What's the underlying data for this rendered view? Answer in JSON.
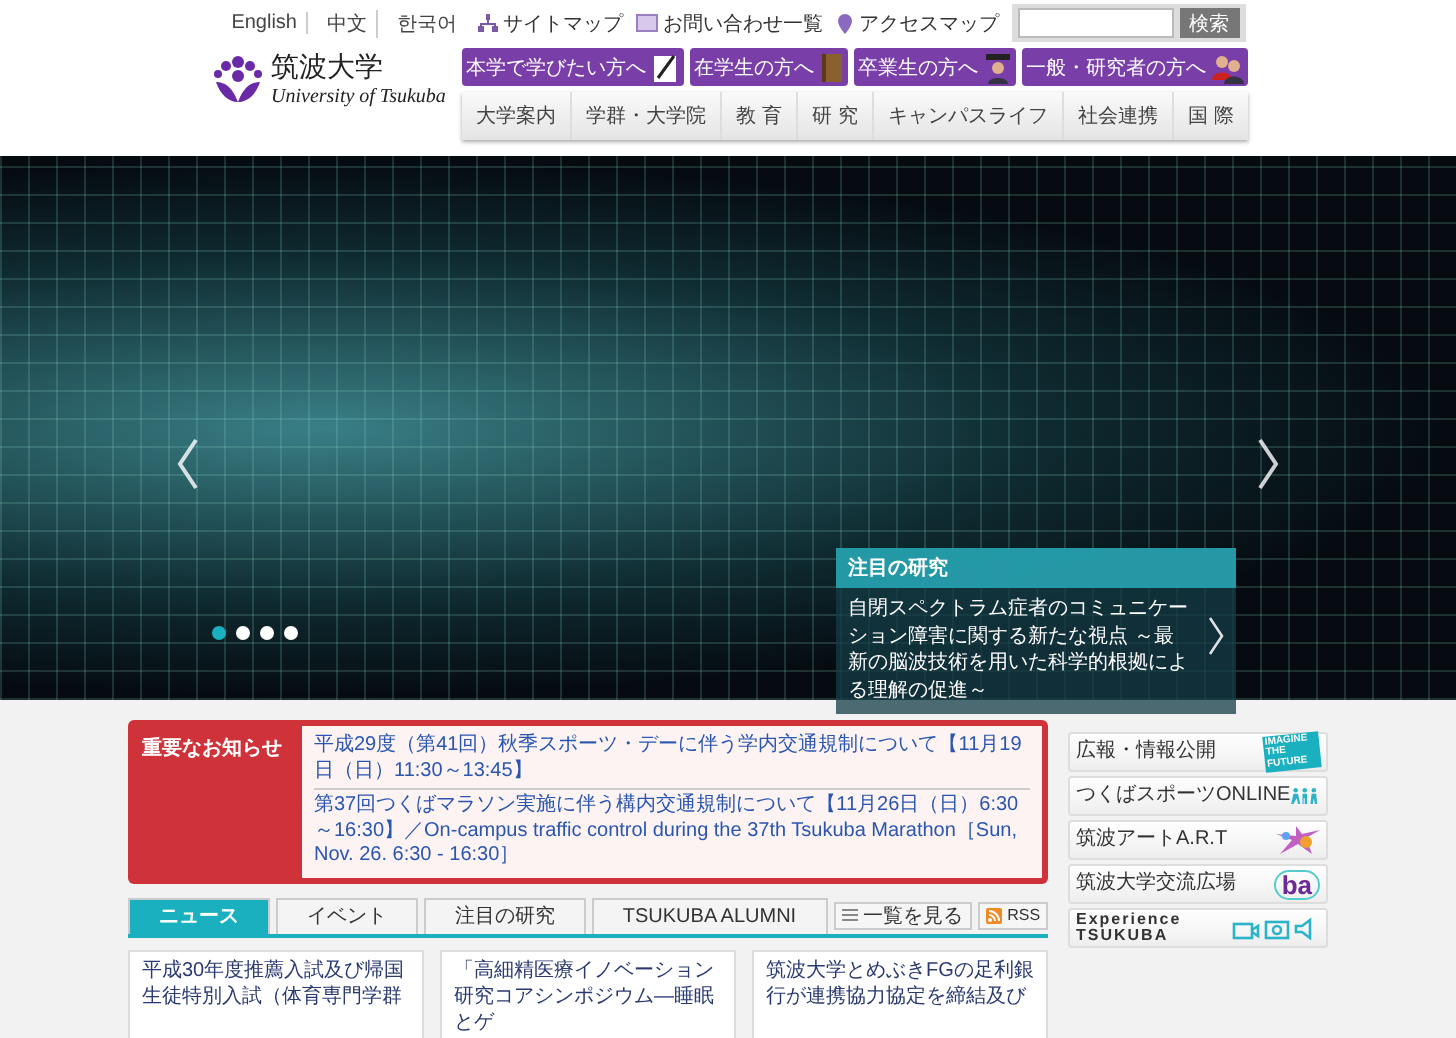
{
  "header": {
    "logo": {
      "name_ja": "筑波大学",
      "name_en": "University of Tsukuba"
    },
    "languages": [
      "English",
      "中文",
      "한국어"
    ],
    "utility_links": [
      "サイトマップ",
      "お問い合わせ一覧",
      "アクセスマップ"
    ],
    "search": {
      "button": "検索"
    },
    "audience_buttons": [
      "本学で学びたい方へ",
      "在学生の方へ",
      "卒業生の方へ",
      "一般・研究者の方へ"
    ],
    "nav": [
      "大学案内",
      "学群・大学院",
      "教 育",
      "研 究",
      "キャンパスライフ",
      "社会連携",
      "国 際"
    ]
  },
  "hero": {
    "slides": [
      {
        "selected": true
      },
      {
        "selected": false
      },
      {
        "selected": false
      },
      {
        "selected": false
      }
    ],
    "caption": {
      "title": "注目の研究",
      "text": "自閉スペクトラム症者のコミュニケーション障害に関する新たな視点 ～最新の脳波技術を用いた科学的根拠による理解の促進～"
    }
  },
  "notices": {
    "label": "重要なお知らせ",
    "items": [
      "平成29度（第41回）秋季スポーツ・デーに伴う学内交通規制について【11月19日（日）11:30～13:45】",
      "第37回つくばマラソン実施に伴う構内交通規制について【11月26日（日）6:30～16:30】／On-campus traffic control during the 37th Tsukuba Marathon［Sun, Nov. 26. 6:30 - 16:30］"
    ]
  },
  "news": {
    "tabs": [
      {
        "label": "ニュース",
        "selected": true
      },
      {
        "label": "イベント",
        "selected": false
      },
      {
        "label": "注目の研究",
        "selected": false
      },
      {
        "label": "TSUKUBA ALUMNI",
        "selected": false
      }
    ],
    "list_button": "一覧を見る",
    "rss": "RSS",
    "cards": [
      "平成30年度推薦入試及び帰国生徒特別入試（体育専門学群",
      "「高細精医療イノベーション研究コアシンポジウム―睡眠とゲ",
      "筑波大学とめぶきFGの足利銀行が連携協力協定を締結及び"
    ]
  },
  "banners": [
    {
      "label": "広報・情報公開",
      "kind": "imagine",
      "badge": "IMAGINE THE FUTURE"
    },
    {
      "label": "つくばスポーツONLINE",
      "kind": "runners"
    },
    {
      "label": "筑波アートA.R.T",
      "kind": "splash"
    },
    {
      "label": "筑波大学交流広場",
      "kind": "ba",
      "badge": "ba"
    },
    {
      "label": "Experience TSUKUBA",
      "kind": "media"
    }
  ]
}
